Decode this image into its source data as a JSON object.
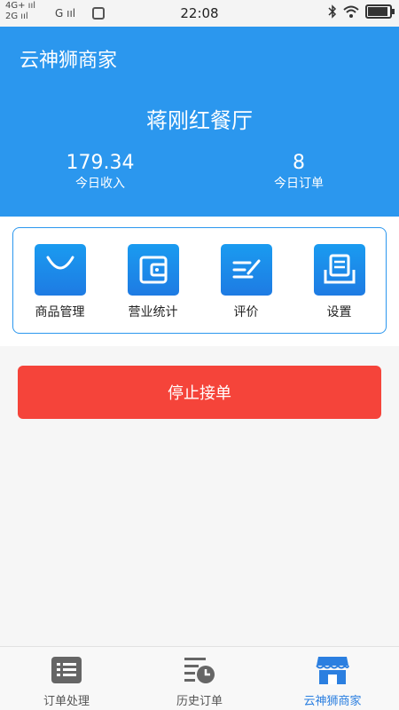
{
  "status_bar": {
    "network_top": "4G+ ııl",
    "network_bottom": "2G ııl",
    "carrier_signal": "G ııl",
    "time": "22:08"
  },
  "header": {
    "app_title": "云神狮商家",
    "shop_name": "蒋刚红餐厅",
    "stats": [
      {
        "value": "179.34",
        "label": "今日收入"
      },
      {
        "value": "8",
        "label": "今日订单"
      }
    ]
  },
  "menu": {
    "items": [
      {
        "label": "商品管理",
        "icon": "shopping-bag-icon"
      },
      {
        "label": "营业统计",
        "icon": "wallet-icon"
      },
      {
        "label": "评价",
        "icon": "edit-note-icon"
      },
      {
        "label": "设置",
        "icon": "document-tray-icon"
      }
    ]
  },
  "action": {
    "stop_label": "停止接单"
  },
  "tabs": [
    {
      "label": "订单处理",
      "icon": "list-icon",
      "active": false
    },
    {
      "label": "历史订单",
      "icon": "history-clock-icon",
      "active": false
    },
    {
      "label": "云神狮商家",
      "icon": "storefront-icon",
      "active": true
    }
  ],
  "colors": {
    "primary": "#2b97ee",
    "danger": "#f5443a",
    "active_tab": "#2b7fe0"
  }
}
